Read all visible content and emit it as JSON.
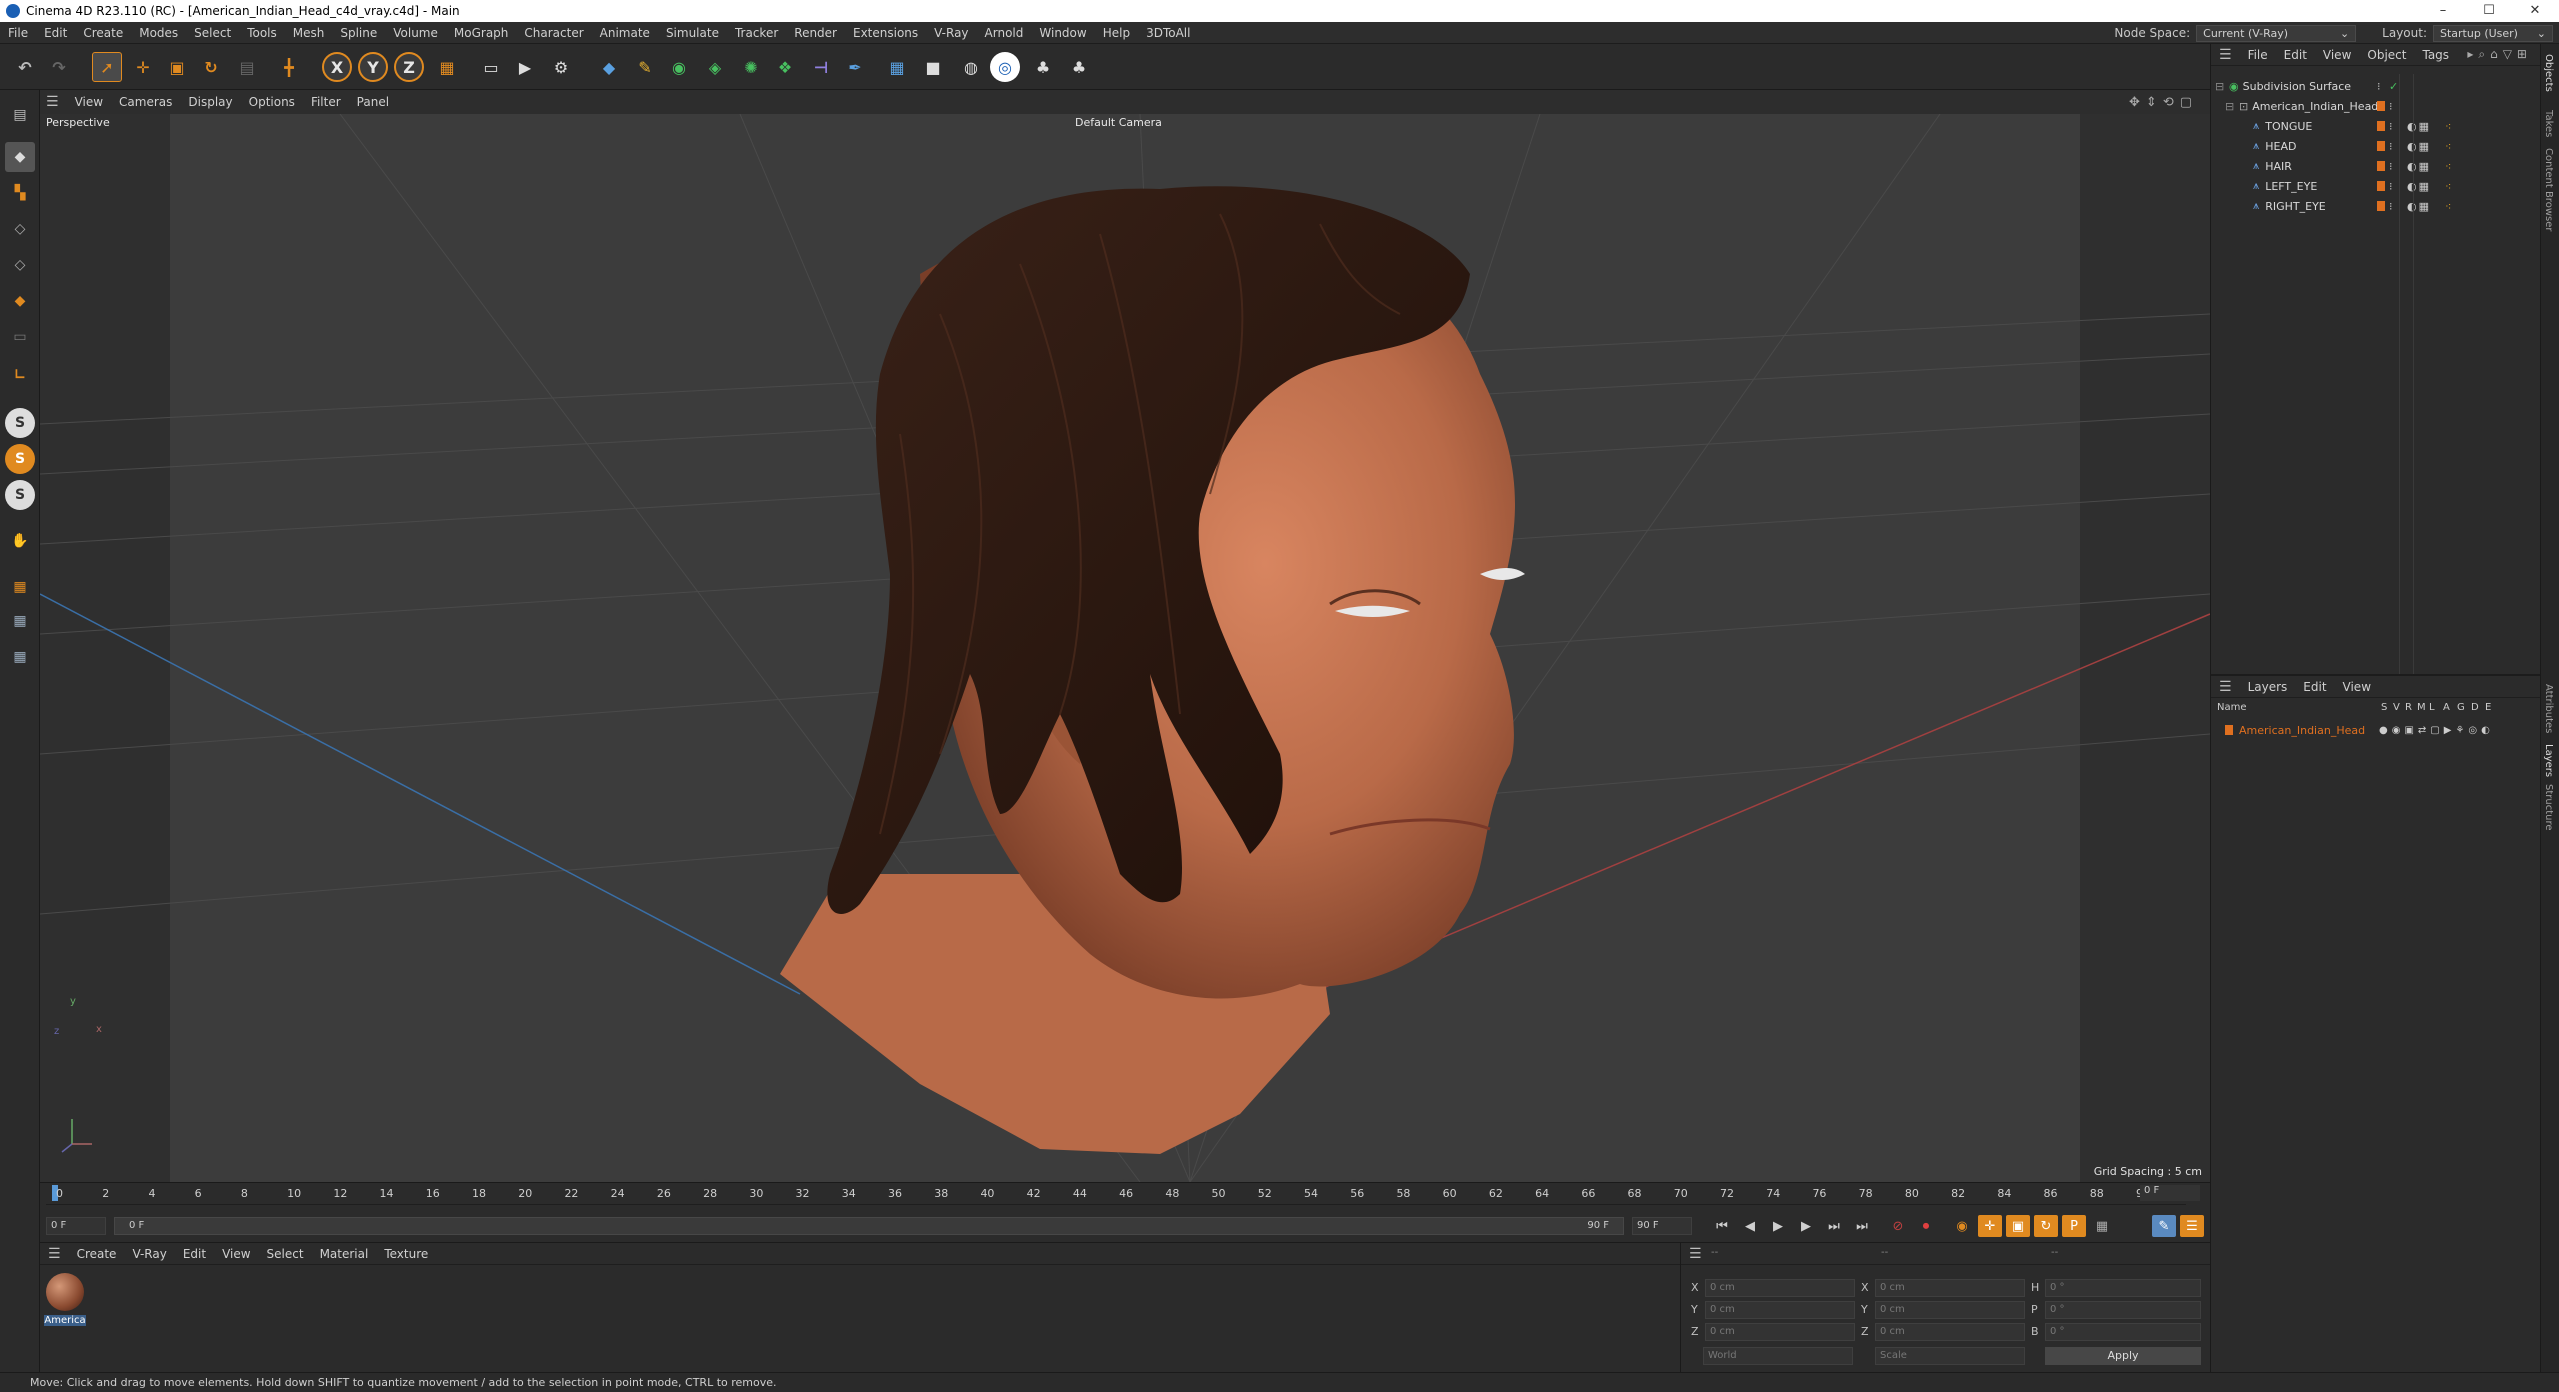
{
  "window": {
    "title": "Cinema 4D R23.110 (RC) - [American_Indian_Head_c4d_vray.c4d] - Main",
    "minimize": "–",
    "maximize": "☐",
    "close": "✕"
  },
  "menubar": {
    "items": [
      "File",
      "Edit",
      "Create",
      "Modes",
      "Select",
      "Tools",
      "Mesh",
      "Spline",
      "Volume",
      "MoGraph",
      "Character",
      "Animate",
      "Simulate",
      "Tracker",
      "Render",
      "Extensions",
      "V-Ray",
      "Arnold",
      "Window",
      "Help",
      "3DToAll"
    ],
    "node_space_label": "Node Space:",
    "node_space_value": "Current (V-Ray)",
    "layout_label": "Layout:",
    "layout_value": "Startup (User)"
  },
  "toolbar": {
    "axis_x": "X",
    "axis_y": "Y",
    "axis_z": "Z"
  },
  "lefttools": {
    "snap_s": "S"
  },
  "viewport": {
    "menu": [
      "View",
      "Cameras",
      "Display",
      "Options",
      "Filter",
      "Panel"
    ],
    "label": "Perspective",
    "camera": "Default Camera",
    "grid_spacing": "Grid Spacing : 5 cm",
    "axis_x": "x",
    "axis_y": "y",
    "axis_z": "z"
  },
  "timeline": {
    "ticks": [
      "0",
      "2",
      "4",
      "6",
      "8",
      "10",
      "12",
      "14",
      "16",
      "18",
      "20",
      "22",
      "24",
      "26",
      "28",
      "30",
      "32",
      "34",
      "36",
      "38",
      "40",
      "42",
      "44",
      "46",
      "48",
      "50",
      "52",
      "54",
      "56",
      "58",
      "60",
      "62",
      "64",
      "66",
      "68",
      "70",
      "72",
      "74",
      "76",
      "78",
      "80",
      "82",
      "84",
      "86",
      "88",
      "90"
    ],
    "current_frame": "0 F",
    "start_field": "0 F",
    "range_start": "0 F",
    "range_end": "90 F",
    "end_field": "90 F"
  },
  "materials": {
    "menu": [
      "Create",
      "V-Ray",
      "Edit",
      "View",
      "Select",
      "Material",
      "Texture"
    ],
    "items": [
      {
        "name": "America"
      }
    ]
  },
  "coords": {
    "header_a": "--",
    "header_b": "--",
    "header_c": "--",
    "rows": [
      {
        "a": "X",
        "av": "0 cm",
        "b": "X",
        "bv": "0 cm",
        "c": "H",
        "cv": "0 °"
      },
      {
        "a": "Y",
        "av": "0 cm",
        "b": "Y",
        "bv": "0 cm",
        "c": "P",
        "cv": "0 °"
      },
      {
        "a": "Z",
        "av": "0 cm",
        "b": "Z",
        "bv": "0 cm",
        "c": "B",
        "cv": "0 °"
      }
    ],
    "world": "World",
    "scale": "Scale",
    "apply": "Apply"
  },
  "objects": {
    "menu": [
      "File",
      "Edit",
      "View",
      "Object",
      "Tags"
    ],
    "items": [
      {
        "name": "Subdivision Surface",
        "indent": 0
      },
      {
        "name": "American_Indian_Head",
        "indent": 1
      },
      {
        "name": "TONGUE",
        "indent": 2
      },
      {
        "name": "HEAD",
        "indent": 2
      },
      {
        "name": "HAIR",
        "indent": 2
      },
      {
        "name": "LEFT_EYE",
        "indent": 2
      },
      {
        "name": "RIGHT_EYE",
        "indent": 2
      }
    ]
  },
  "layers": {
    "menu": [
      "Layers",
      "Edit",
      "View"
    ],
    "header_name": "Name",
    "header_cols": [
      "S",
      "V",
      "R",
      "M",
      "L",
      "A",
      "G",
      "D",
      "E"
    ],
    "items": [
      {
        "name": "American_Indian_Head"
      }
    ]
  },
  "sidetabs": [
    "Objects",
    "Takes",
    "Content Browser",
    "Attributes",
    "Layers",
    "Structure"
  ],
  "status": "Move: Click and drag to move elements. Hold down SHIFT to quantize movement / add to the selection in point mode, CTRL to remove.",
  "colors": {
    "accent": "#e07020",
    "selected_bg": "#3a5f8a",
    "object_green": "#48c060"
  }
}
